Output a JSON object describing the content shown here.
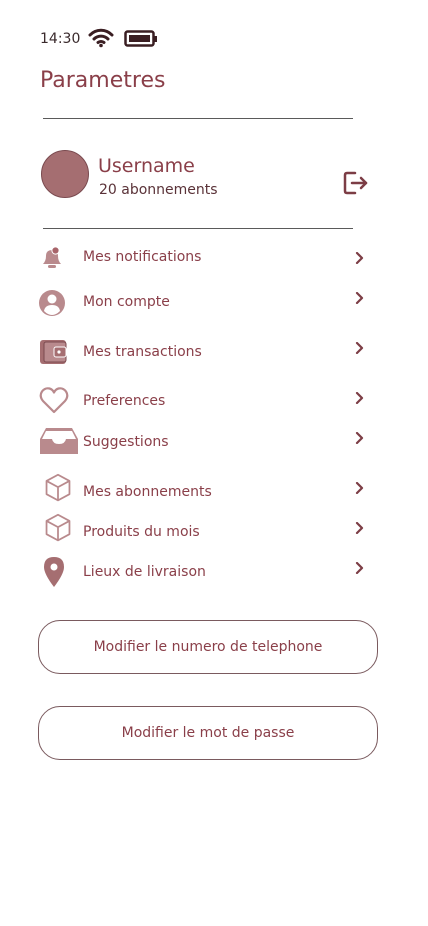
{
  "status_bar": {
    "time": "14:30"
  },
  "header": {
    "title": "Parametres"
  },
  "profile": {
    "username": "Username",
    "followers": "20 abonnements"
  },
  "menu": {
    "items": [
      {
        "label": "Mes notifications",
        "icon": "bell-icon"
      },
      {
        "label": "Mon  compte",
        "icon": "account-icon"
      },
      {
        "label": "Mes transactions",
        "icon": "wallet-icon"
      },
      {
        "label": "Preferences",
        "icon": "heart-icon"
      },
      {
        "label": "Suggestions",
        "icon": "inbox-icon"
      },
      {
        "label": "Mes abonnements",
        "icon": "box-icon"
      },
      {
        "label": "Produits du mois",
        "icon": "box-icon"
      },
      {
        "label": "Lieux de livraison",
        "icon": "location-pin-icon"
      }
    ]
  },
  "buttons": {
    "change_phone": "Modifier le numero de telephone",
    "change_password": "Modifier le mot de passe"
  },
  "colors": {
    "accent": "#8a3f49",
    "icon_fill": "#b98a8d",
    "avatar": "#a56e71"
  }
}
